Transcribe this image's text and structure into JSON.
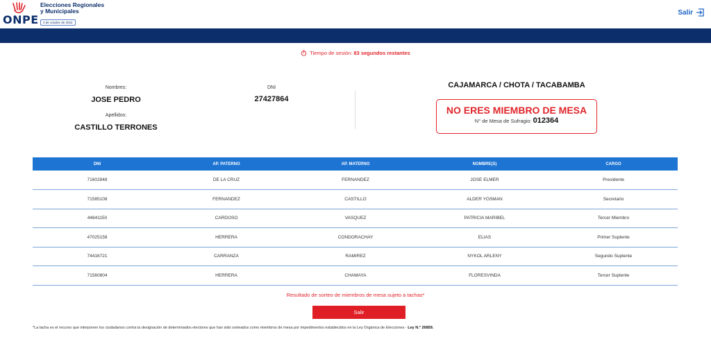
{
  "header": {
    "logo_text": "ONPE",
    "event_title_line1": "Elecciones Regionales",
    "event_title_line2": "y Municipales",
    "event_date": "2 de octubre de 2022",
    "logout_label": "Salir",
    "brand_color": "#0c2e6b",
    "accent_color": "#e0242a"
  },
  "session": {
    "prefix": "Tiempo de sesión:",
    "remaining": "83 segundos restantes"
  },
  "person": {
    "names_label": "Nombres:",
    "names_value": "JOSE PEDRO",
    "dni_label": "DNI",
    "dni_value": "27427864",
    "surnames_label": "Apellidos:",
    "surnames_value": "CASTILLO TERRONES"
  },
  "result": {
    "location": "CAJAMARCA / CHOTA / TACABAMBA",
    "status": "NO ERES MIEMBRO DE MESA",
    "mesa_label": "N° de Mesa de Sufragio:",
    "mesa_number": "012364"
  },
  "table": {
    "headers": [
      "DNI",
      "AP. PATERNO",
      "AP. MATERNO",
      "NOMBRE(S)",
      "CARGO"
    ],
    "rows": [
      [
        "71602848",
        "DE LA CRUZ",
        "FERNANDEZ",
        "JOSE ELMER",
        "Presidente"
      ],
      [
        "71585108",
        "FERNANDEZ",
        "CASTILLO",
        "ALDER YOSMAN",
        "Secretario"
      ],
      [
        "44841150",
        "CARDOSO",
        "VASQUEZ",
        "PATRICIA MARIBEL",
        "Tercer Miembro"
      ],
      [
        "47025158",
        "HERRERA",
        "CONDORACHAY",
        "ELIAS",
        "Primer Suplente"
      ],
      [
        "74416721",
        "CARRANZA",
        "RAMIREZ",
        "NYKOL ARLENY",
        "Segundo Suplente"
      ],
      [
        "71560804",
        "HERRERA",
        "CHAMAYA",
        "FLORESVINDA",
        "Tercer Suplente"
      ]
    ]
  },
  "footer": {
    "sorteo_note": "Resultado de sorteo de miembros de mesa sujeto a tachas*",
    "button_label": "Salir",
    "footnote_text": "*La tacha es el recurso que interponen los ciudadanos contra la designación de determinados electores que han sido sorteados como miembros de mesa por impedimentos establecidos en la Ley Orgánica de Elecciones - ",
    "footnote_law": "Ley N.° 26859."
  }
}
